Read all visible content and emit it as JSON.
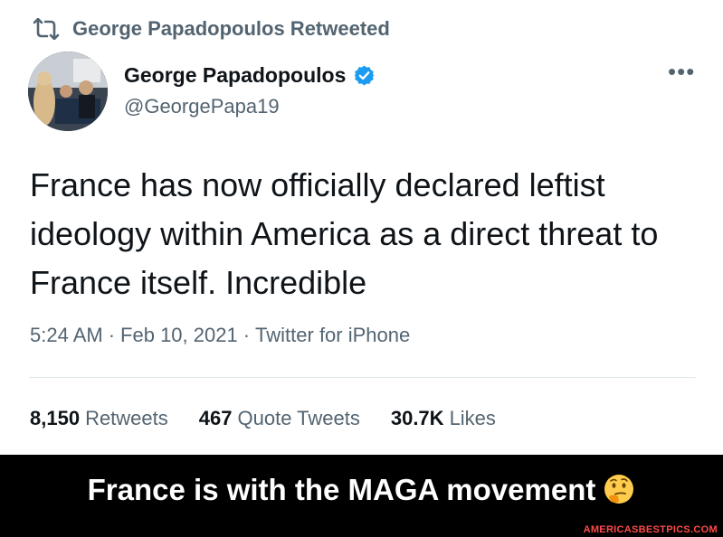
{
  "retweet": {
    "icon": "retweet-icon",
    "label": "George Papadopoulos Retweeted"
  },
  "author": {
    "name": "George Papadopoulos",
    "handle": "@GeorgePapa19",
    "verified_icon": "verified-badge-icon"
  },
  "more_label": "•••",
  "tweet": {
    "text": "France has now officially declared leftist ideology within America as a direct threat to France itself. Incredible",
    "time": "5:24 AM",
    "date": "Feb 10, 2021",
    "source": "Twitter for iPhone",
    "separator": "·"
  },
  "stats": {
    "retweets_count": "8,150",
    "retweets_label": "Retweets",
    "quotes_count": "467",
    "quotes_label": "Quote Tweets",
    "likes_count": "30.7K",
    "likes_label": "Likes"
  },
  "caption": {
    "text": "France is with the MAGA movement",
    "emoji": "thinking-face-icon"
  },
  "watermark": "AMERICASBESTPICS.COM",
  "colors": {
    "secondary": "#536471",
    "primary": "#0f1419",
    "verified": "#1d9bf0",
    "caption_bg": "#000000",
    "watermark": "#ff4a4a"
  }
}
